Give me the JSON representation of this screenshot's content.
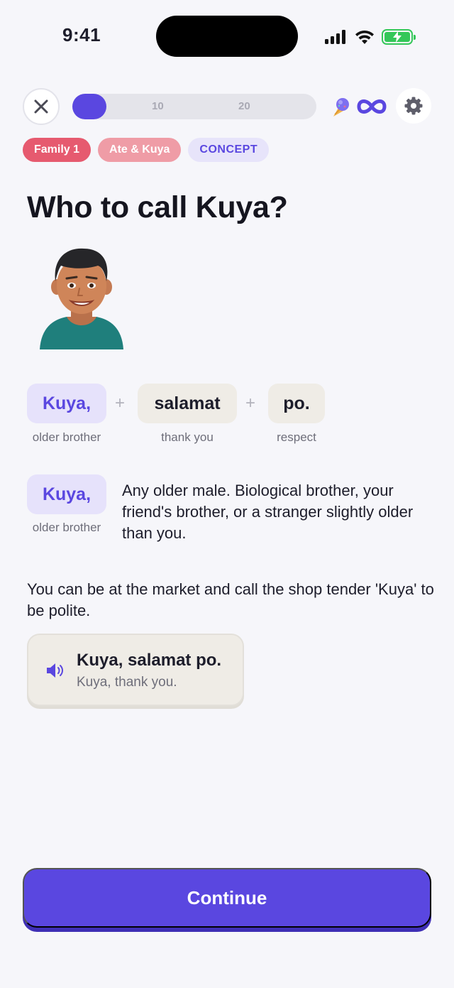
{
  "status_bar": {
    "time": "9:41"
  },
  "tags": [
    "Family 1",
    "Ate & Kuya",
    "CONCEPT"
  ],
  "progress": {
    "ticks": [
      "10",
      "20"
    ],
    "completed_fraction": 0.14
  },
  "title": "Who to call Kuya?",
  "words": [
    {
      "word": "Kuya,",
      "gloss": "older brother"
    },
    {
      "word": "salamat",
      "gloss": "thank you"
    },
    {
      "word": "po.",
      "gloss": "respect"
    }
  ],
  "plus_sign": "+",
  "definition": {
    "word": "Kuya,",
    "gloss": "older brother",
    "text": "Any older male. Biological brother, your friend's brother, or a stranger slightly older than you."
  },
  "example_text": "You can be at the market and call the shop tender 'Kuya' to be polite.",
  "audio_example": {
    "phrase": "Kuya, salamat po.",
    "translation": "Kuya, thank you."
  },
  "continue_label": "Continue",
  "colors": {
    "accent": "#5a47e0",
    "tag_family": "#e65a6f",
    "tag_ate": "#ef9ca6",
    "chip_purple": "#e6e2fb",
    "chip_beige": "#efece6",
    "background": "#f6f6fa"
  }
}
